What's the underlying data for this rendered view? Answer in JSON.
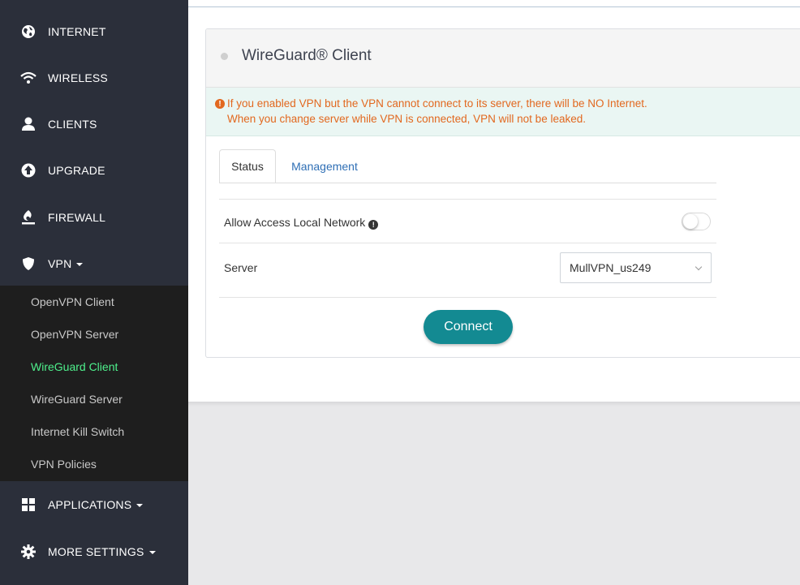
{
  "sidebar": {
    "items": [
      {
        "label": "INTERNET",
        "icon": "globe-icon"
      },
      {
        "label": "WIRELESS",
        "icon": "wifi-icon"
      },
      {
        "label": "CLIENTS",
        "icon": "user-icon"
      },
      {
        "label": "UPGRADE",
        "icon": "upgrade-icon"
      },
      {
        "label": "FIREWALL",
        "icon": "firewall-icon"
      },
      {
        "label": "VPN",
        "icon": "shield-icon"
      },
      {
        "label": "APPLICATIONS",
        "icon": "grid-icon"
      },
      {
        "label": "MORE SETTINGS",
        "icon": "gear-icon"
      }
    ],
    "vpn_submenu": [
      {
        "label": "OpenVPN Client"
      },
      {
        "label": "OpenVPN Server"
      },
      {
        "label": "WireGuard Client",
        "active": true
      },
      {
        "label": "WireGuard Server"
      },
      {
        "label": "Internet Kill Switch"
      },
      {
        "label": "VPN Policies"
      }
    ]
  },
  "panel": {
    "title": "WireGuard® Client",
    "alert": {
      "line1": "If you enabled VPN but the VPN cannot connect to its server, there will be NO Internet.",
      "line2": "When you change server while VPN is connected, VPN will not be leaked."
    },
    "tabs": [
      {
        "label": "Status",
        "active": true
      },
      {
        "label": "Management",
        "active": false
      }
    ],
    "rows": {
      "allow_local": {
        "label": "Allow Access Local Network",
        "enabled": false
      },
      "server": {
        "label": "Server",
        "value": "MullVPN_us249"
      }
    },
    "connect_label": "Connect"
  },
  "colors": {
    "sidebar_bg": "#2b2f3a",
    "submenu_bg": "#1e1e1e",
    "active_submenu": "#4ef08c",
    "alert_text": "#e2681f",
    "alert_bg": "#eaf6f3",
    "connect_button": "#138a92",
    "tab_link": "#2f6fb5"
  }
}
